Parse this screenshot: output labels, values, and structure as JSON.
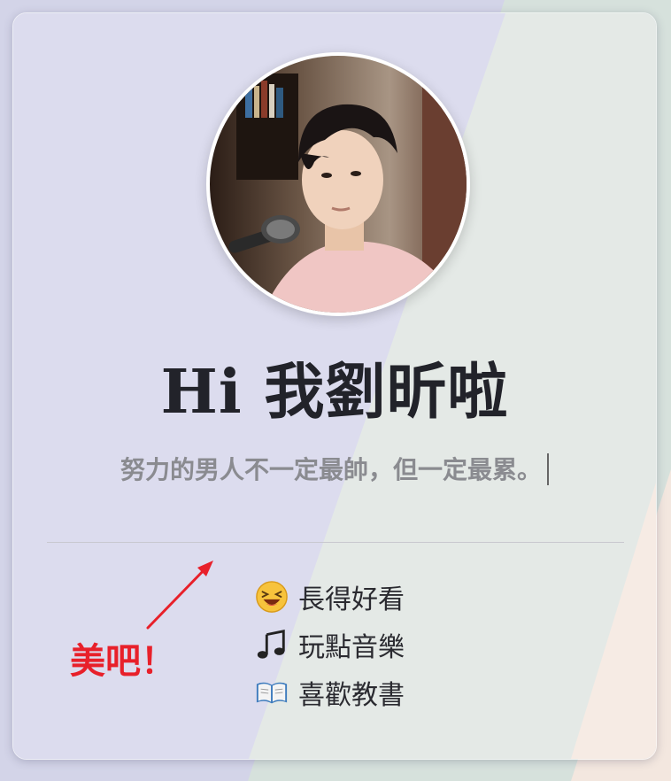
{
  "profile": {
    "greeting": "Hi 我劉昕啦",
    "motto": "努力的男人不一定最帥，但一定最累。"
  },
  "annotation": {
    "text": "美吧！",
    "color": "#e8202a"
  },
  "hobbies": [
    {
      "icon": "laughing-face-icon",
      "label": "長得好看"
    },
    {
      "icon": "music-note-icon",
      "label": "玩點音樂"
    },
    {
      "icon": "open-book-icon",
      "label": "喜歡教書"
    }
  ],
  "colors": {
    "background_lavender": "#d3d4e8",
    "background_mint": "#d6e1dc",
    "background_peach": "#f3e7df",
    "title": "#22232a",
    "subtitle": "#8a8b90"
  }
}
